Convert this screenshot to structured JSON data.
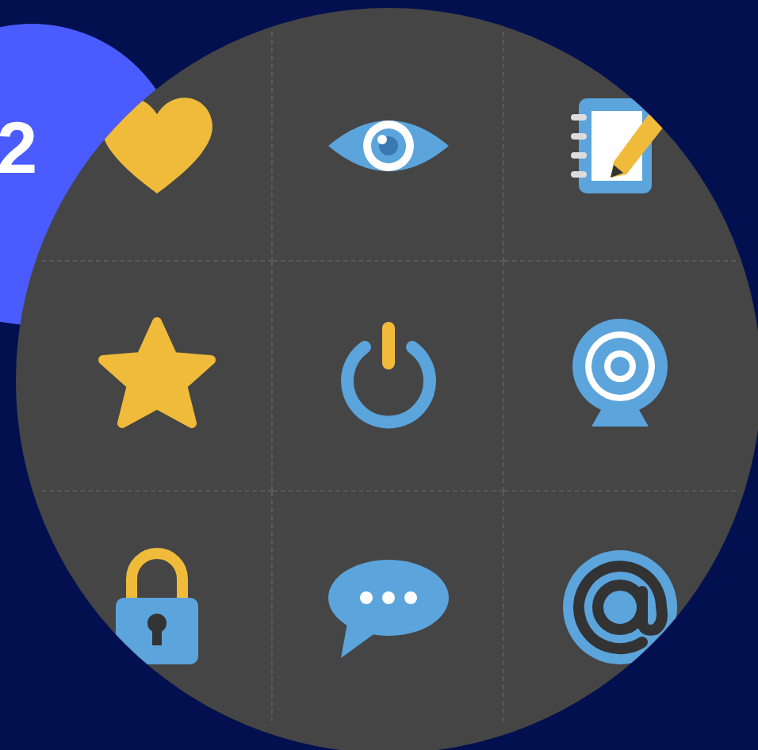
{
  "badge": {
    "text": "2"
  },
  "icons": [
    {
      "kind": "heart"
    },
    {
      "kind": "eye"
    },
    {
      "kind": "notebook"
    },
    {
      "kind": "star"
    },
    {
      "kind": "power"
    },
    {
      "kind": "webcam"
    },
    {
      "kind": "lock"
    },
    {
      "kind": "chat"
    },
    {
      "kind": "at"
    }
  ]
}
